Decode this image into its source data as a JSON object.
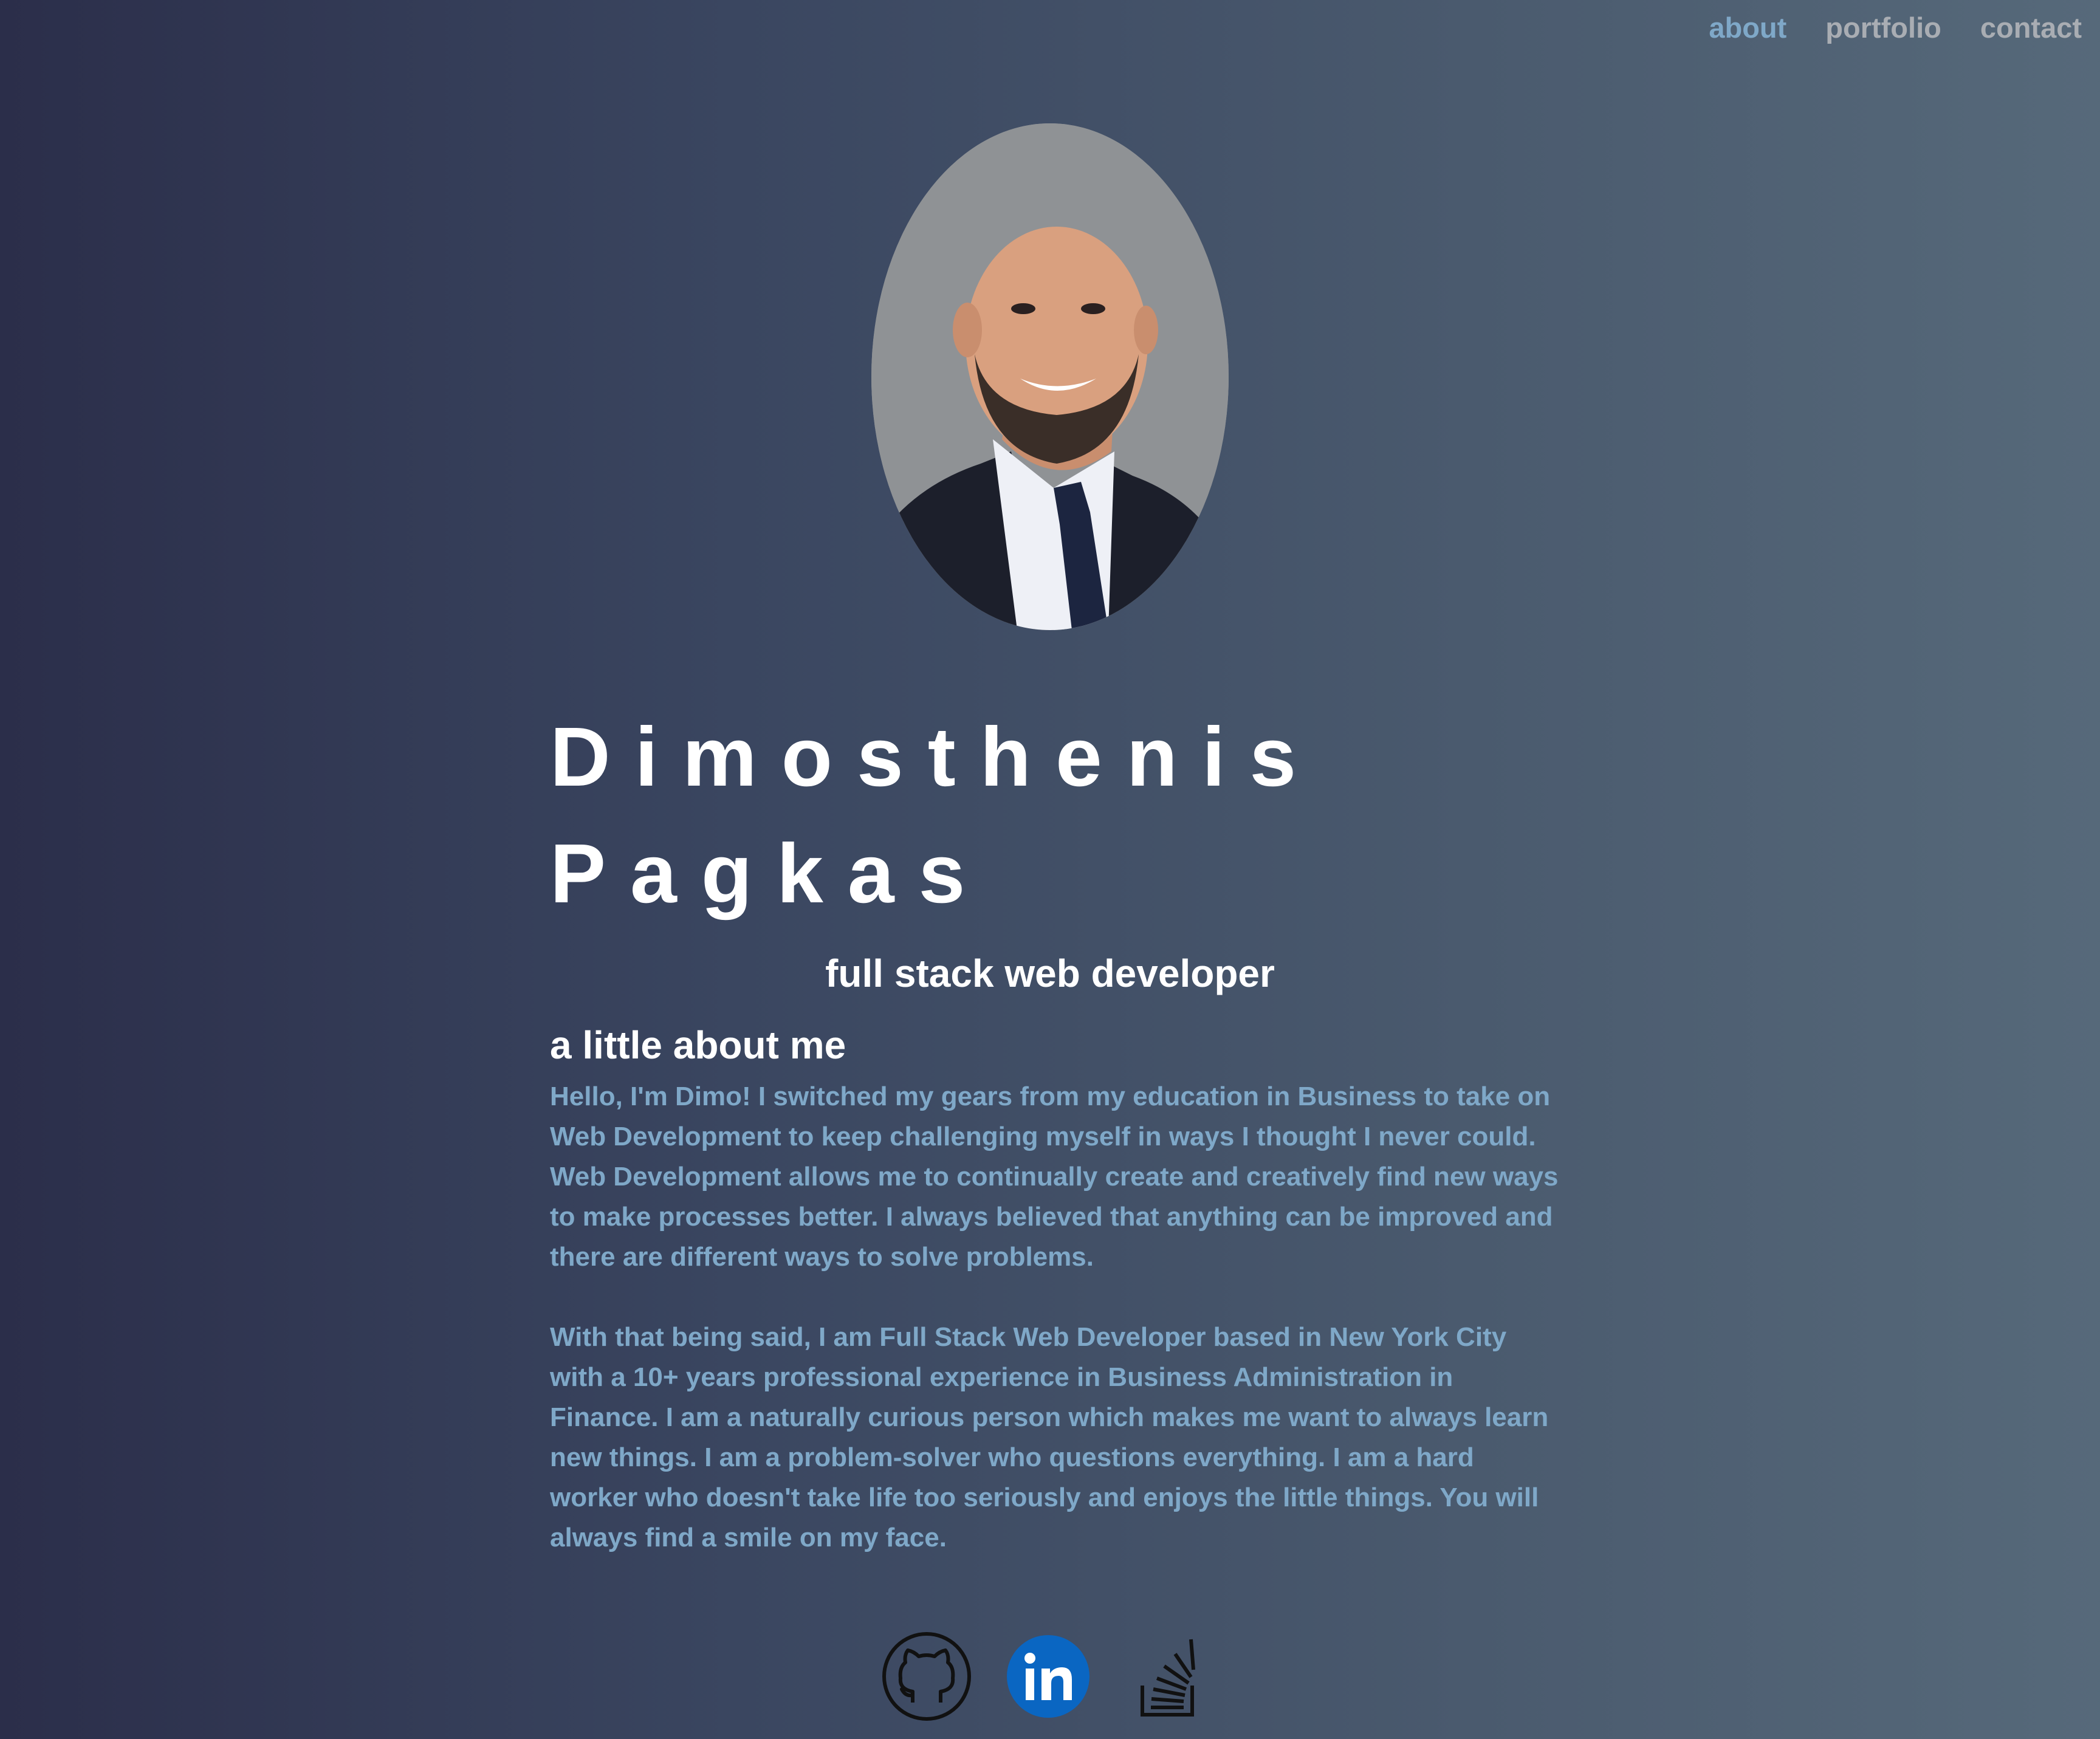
{
  "nav": {
    "items": [
      {
        "label": "about",
        "active": true
      },
      {
        "label": "portfolio",
        "active": false
      },
      {
        "label": "contact",
        "active": false
      }
    ]
  },
  "profile": {
    "name_line1": "Dimosthenis",
    "name_line2": "Pagkas",
    "title": "full stack web developer",
    "photo_icon": "portrait-photo"
  },
  "about": {
    "heading": "a little about me",
    "paragraph1": "Hello, I'm Dimo! I switched my gears from my education in Business to take on Web Development to keep challenging myself in ways I thought I never could. Web Development allows me to continually create and creatively find new ways to make processes better. I always believed that anything can be improved and there are different ways to solve problems.",
    "paragraph2": "With that being said, I am Full Stack Web Developer based in New York City with a 10+ years professional experience in Business Administration in Finance. I am a naturally curious person which makes me want to always learn new things. I am a problem-solver who questions everything. I am a hard worker who doesn't take life too seriously and enjoys the little things. You will always find a smile on my face."
  },
  "socials": [
    {
      "name": "github-icon"
    },
    {
      "name": "linkedin-icon"
    },
    {
      "name": "stackoverflow-icon"
    }
  ],
  "colors": {
    "accent": "#7fa8c8",
    "nav_inactive": "#a9adb3",
    "text_white": "#ffffff",
    "linkedin_blue": "#0a66c2"
  }
}
